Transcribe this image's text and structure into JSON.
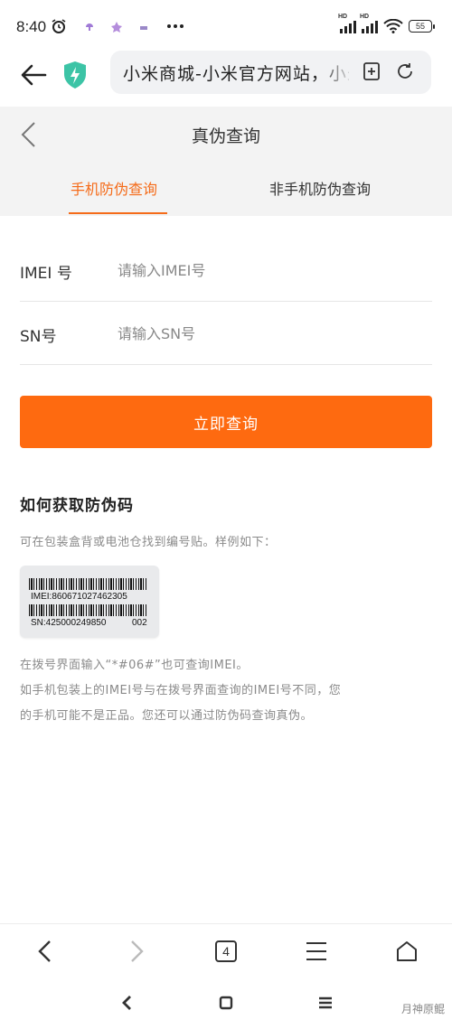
{
  "status_bar": {
    "time": "8:40",
    "battery": "55",
    "signal_label": "HD"
  },
  "browser": {
    "url_title": "小米商城-小米官方网站，小米手机"
  },
  "page": {
    "title": "真伪查询",
    "tabs": [
      {
        "label": "手机防伪查询",
        "active": true
      },
      {
        "label": "非手机防伪查询",
        "active": false
      }
    ]
  },
  "form": {
    "imei_label": "IMEI 号",
    "imei_placeholder": "请输入IMEI号",
    "sn_label": "SN号",
    "sn_placeholder": "请输入SN号",
    "submit_label": "立即查询"
  },
  "info": {
    "title": "如何获取防伪码",
    "desc": "可在包装盒背或电池仓找到编号贴。样例如下：",
    "sample": {
      "imei": "IMEI:860671027462305",
      "sn": "SN:425000249850",
      "code": "002"
    },
    "notes": [
      "在拨号界面输入“*#06#”也可查询IMEI。",
      "如手机包装上的IMEI号与在拨号界面查询的IMEI号不同，您",
      "的手机可能不是正品。您还可以通过防伪码查询真伪。"
    ]
  },
  "bottom_nav": {
    "tab_count": "4"
  },
  "watermark": "月神原鲲",
  "colors": {
    "accent": "#fe6a10",
    "tab_active": "#f56b19",
    "header_bg": "#f3f3f3",
    "shield": "#3cc4a6"
  }
}
